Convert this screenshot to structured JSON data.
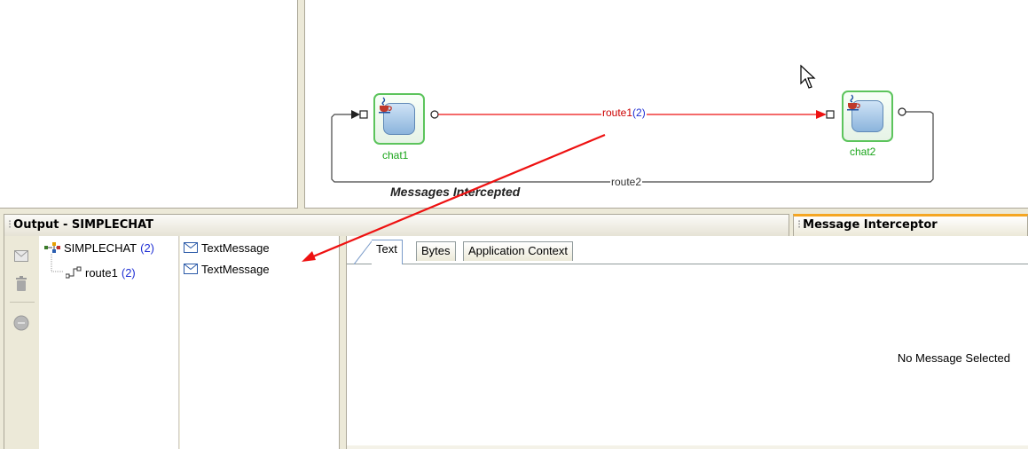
{
  "canvas": {
    "nodes": [
      {
        "label": "chat1"
      },
      {
        "label": "chat2"
      }
    ],
    "route1": {
      "name": "route1",
      "count": "(2)"
    },
    "route2": {
      "name": "route2"
    },
    "annotation": "Messages Intercepted"
  },
  "output_panel": {
    "title": "Output - SIMPLECHAT",
    "toolbar": [
      {
        "icon": "envelope-icon"
      },
      {
        "icon": "trash-icon"
      },
      {
        "icon": "stop-icon"
      }
    ],
    "tree": [
      {
        "label": "SIMPLECHAT",
        "count": "(2)",
        "icon": "network-icon"
      },
      {
        "label": "route1",
        "count": "(2)",
        "icon": "route-icon"
      }
    ],
    "messages": [
      {
        "label": "TextMessage",
        "icon": "envelope-icon"
      },
      {
        "label": "TextMessage",
        "icon": "envelope-icon"
      }
    ]
  },
  "message_interceptor": {
    "title": "Message Interceptor",
    "tabs": [
      {
        "label": "Text",
        "active": true
      },
      {
        "label": "Bytes",
        "active": false
      },
      {
        "label": "Application Context",
        "active": false
      }
    ],
    "empty_text": "No Message Selected"
  },
  "colors": {
    "route_active": "#ee1111",
    "node_border": "#5cc45c",
    "node_label": "#1aa51a",
    "count_blue": "#1f2fd4",
    "active_header_accent": "#f5a623"
  }
}
